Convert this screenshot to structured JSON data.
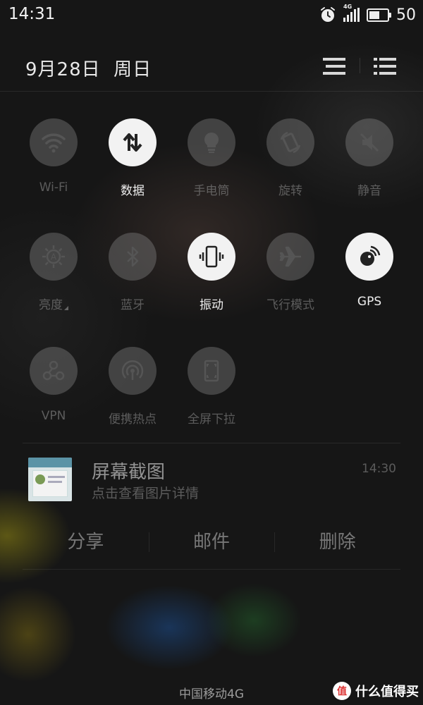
{
  "status_bar": {
    "time": "14:31",
    "network": "4G",
    "battery_level": "50",
    "icons": [
      "alarm-icon",
      "signal-icon",
      "battery-icon"
    ]
  },
  "header": {
    "date": "9月28日",
    "weekday": "周日",
    "icons": [
      "notification-list-icon",
      "settings-list-icon"
    ]
  },
  "toggles": [
    {
      "label": "Wi-Fi",
      "icon": "wifi-icon",
      "on": false
    },
    {
      "label": "数据",
      "icon": "data-transfer-icon",
      "on": true
    },
    {
      "label": "手电筒",
      "icon": "flashlight-icon",
      "on": false
    },
    {
      "label": "旋转",
      "icon": "rotate-icon",
      "on": false
    },
    {
      "label": "静音",
      "icon": "mute-icon",
      "on": false
    },
    {
      "label": "亮度",
      "icon": "brightness-icon",
      "on": false
    },
    {
      "label": "蓝牙",
      "icon": "bluetooth-icon",
      "on": false
    },
    {
      "label": "振动",
      "icon": "vibrate-icon",
      "on": true
    },
    {
      "label": "飞行模式",
      "icon": "airplane-icon",
      "on": false
    },
    {
      "label": "GPS",
      "icon": "gps-icon",
      "on": true
    },
    {
      "label": "VPN",
      "icon": "vpn-icon",
      "on": false
    },
    {
      "label": "便携热点",
      "icon": "hotspot-icon",
      "on": false
    },
    {
      "label": "全屏下拉",
      "icon": "fullscreen-pulldown-icon",
      "on": false
    }
  ],
  "notification": {
    "title": "屏幕截图",
    "subtitle": "点击查看图片详情",
    "time": "14:30",
    "actions": [
      "分享",
      "邮件",
      "删除"
    ]
  },
  "carrier": "中国移动4G",
  "watermark": {
    "logo_text": "值",
    "text": "什么值得买"
  },
  "colors": {
    "toggle_on": "#f2f2f2",
    "toggle_off": "rgba(140,140,140,0.38)",
    "background": "#161616"
  }
}
